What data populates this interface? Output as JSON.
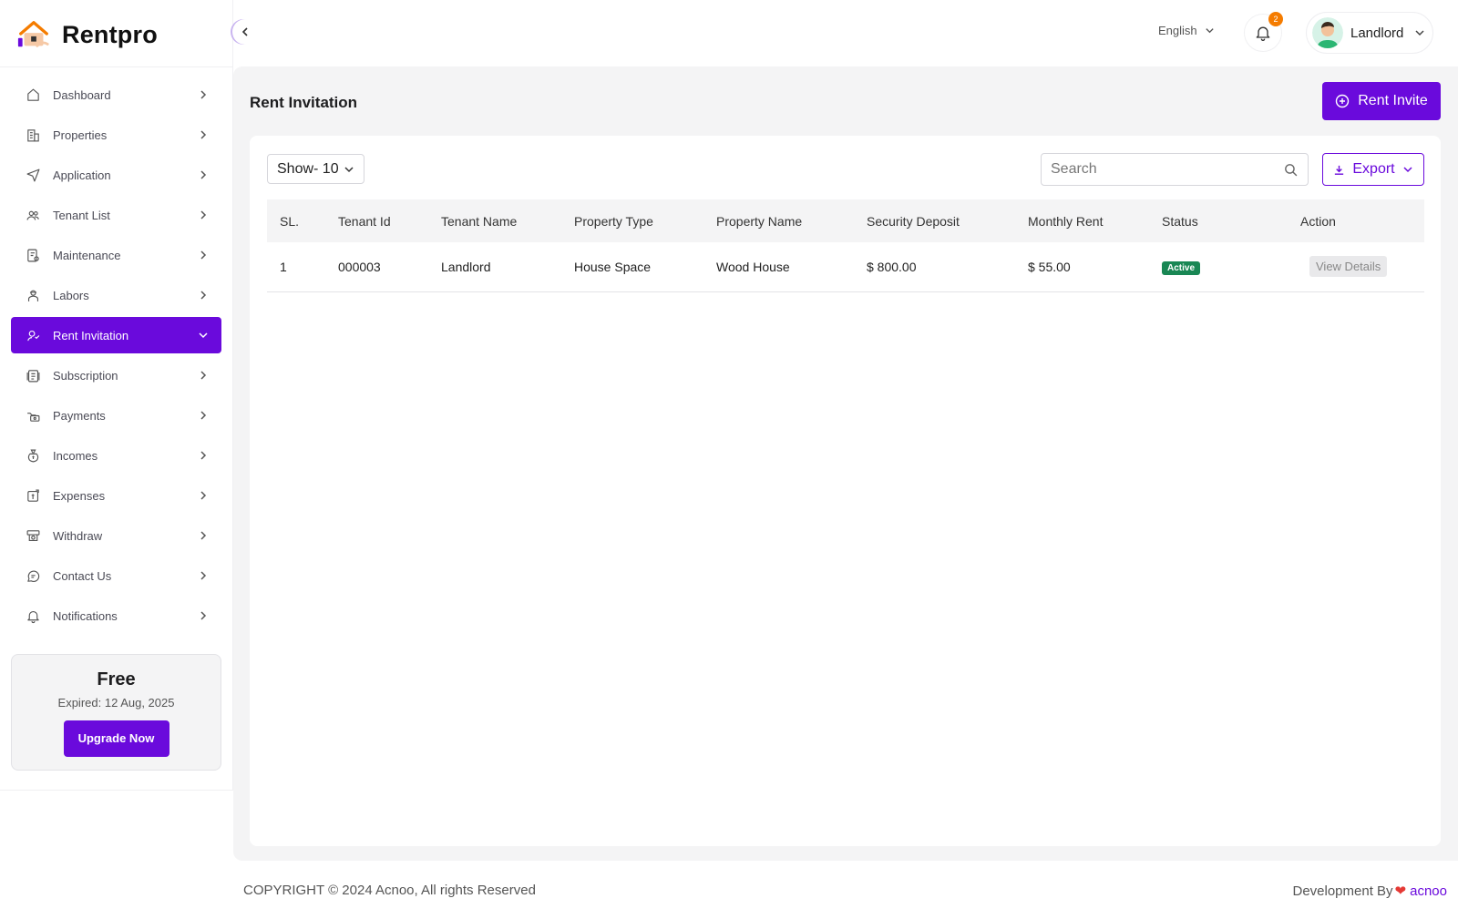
{
  "brand": {
    "name": "Rentpro"
  },
  "sidebar": {
    "items": [
      {
        "label": "Dashboard",
        "icon": "home-icon"
      },
      {
        "label": "Properties",
        "icon": "building-icon"
      },
      {
        "label": "Application",
        "icon": "send-icon"
      },
      {
        "label": "Tenant List",
        "icon": "users-icon"
      },
      {
        "label": "Maintenance",
        "icon": "wrench-icon"
      },
      {
        "label": "Labors",
        "icon": "worker-icon"
      },
      {
        "label": "Rent Invitation",
        "icon": "invite-icon",
        "active": true
      },
      {
        "label": "Subscription",
        "icon": "subscription-icon"
      },
      {
        "label": "Payments",
        "icon": "payment-icon"
      },
      {
        "label": "Incomes",
        "icon": "money-bag-icon"
      },
      {
        "label": "Expenses",
        "icon": "expense-icon"
      },
      {
        "label": "Withdraw",
        "icon": "withdraw-icon"
      },
      {
        "label": "Contact Us",
        "icon": "chat-icon"
      },
      {
        "label": "Notifications",
        "icon": "bell-icon"
      }
    ],
    "plan": {
      "name": "Free",
      "expiry": "Expired: 12 Aug, 2025",
      "upgrade_label": "Upgrade Now"
    }
  },
  "topbar": {
    "language": "English",
    "notification_count": "2",
    "user_name": "Landlord"
  },
  "main": {
    "title": "Rent Invitation",
    "invite_label": "Rent Invite",
    "show_label": "Show- 10",
    "search_placeholder": "Search",
    "export_label": "Export",
    "table": {
      "headers": [
        "SL.",
        "Tenant Id",
        "Tenant Name",
        "Property Type",
        "Property Name",
        "Security Deposit",
        "Monthly Rent",
        "Status",
        "Action"
      ],
      "rows": [
        {
          "sl": "1",
          "tenant_id": "000003",
          "tenant_name": "Landlord",
          "property_type": "House Space",
          "property_name": "Wood House",
          "security_deposit": "$ 800.00",
          "monthly_rent": "$ 55.00",
          "status": "Active",
          "action": "View Details"
        }
      ]
    }
  },
  "footer": {
    "copyright": "COPYRIGHT © 2024 Acnoo, All rights Reserved",
    "dev_prefix": "Development By",
    "dev_brand": "acnoo"
  },
  "colors": {
    "accent": "#6a0adc",
    "status_active": "#198754",
    "badge": "#f57c00"
  }
}
